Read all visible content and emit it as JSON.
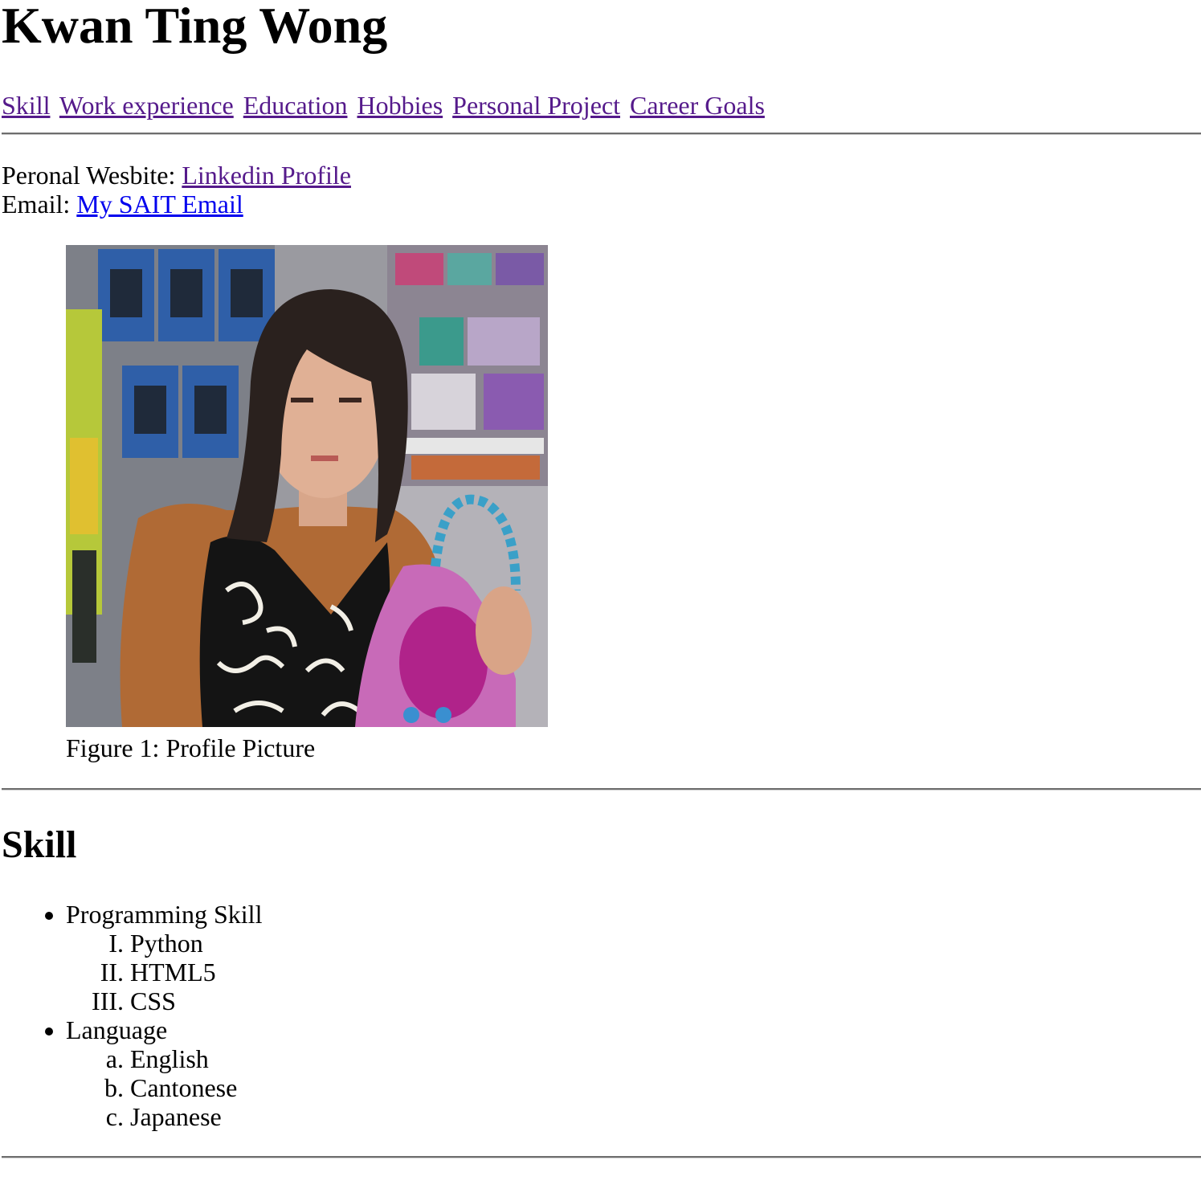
{
  "header": {
    "name": "Kwan Ting Wong"
  },
  "nav": {
    "links": [
      {
        "label": "Skill"
      },
      {
        "label": "Work experience"
      },
      {
        "label": "Education"
      },
      {
        "label": "Hobbies"
      },
      {
        "label": "Personal Project"
      },
      {
        "label": "Career Goals"
      }
    ]
  },
  "contact": {
    "website_label": "Peronal Wesbite: ",
    "website_link": "Linkedin Profile",
    "email_label": "Email: ",
    "email_link": "My SAIT Email"
  },
  "figure": {
    "caption": "Figure 1: Profile Picture"
  },
  "skill_section": {
    "title": "Skill",
    "groups": [
      {
        "label": "Programming Skill",
        "items": [
          "Python",
          "HTML5",
          "CSS"
        ]
      },
      {
        "label": "Language",
        "items": [
          "English",
          "Cantonese",
          "Japanese"
        ]
      }
    ]
  },
  "colors": {
    "visited_link": "#551a8b",
    "unvisited_link": "#0000ee",
    "rule": "#6e6e6e"
  }
}
